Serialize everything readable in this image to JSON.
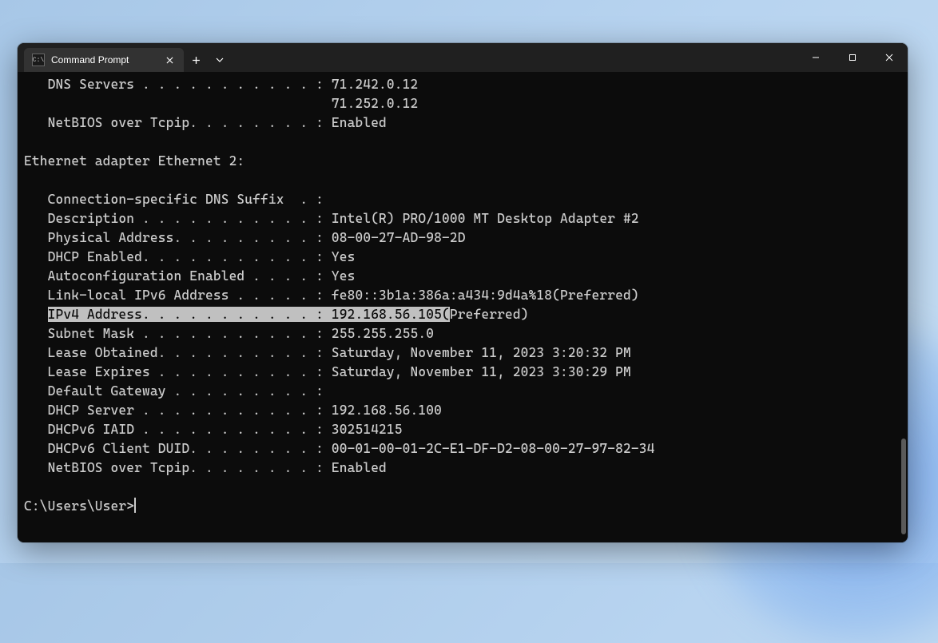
{
  "titlebar": {
    "tab_title": "Command Prompt",
    "tab_icon_text": "C:\\"
  },
  "output": {
    "partial_top": [
      "   DNS Servers . . . . . . . . . . . : 71.242.0.12",
      "                                       71.252.0.12",
      "   NetBIOS over Tcpip. . . . . . . . : Enabled",
      ""
    ],
    "section_header": "Ethernet adapter Ethernet 2:",
    "blank": "",
    "details_before_hl": [
      "   Connection-specific DNS Suffix  . :",
      "   Description . . . . . . . . . . . : Intel(R) PRO/1000 MT Desktop Adapter #2",
      "   Physical Address. . . . . . . . . : 08-00-27-AD-98-2D",
      "   DHCP Enabled. . . . . . . . . . . : Yes",
      "   Autoconfiguration Enabled . . . . : Yes",
      "   Link-local IPv6 Address . . . . . : fe80::3b1a:386a:a434:9d4a%18(Preferred)"
    ],
    "hl_prefix": "   ",
    "hl_selected": "IPv4 Address. . . . . . . . . . . : 192.168.56.105(",
    "hl_suffix": "Preferred)",
    "details_after_hl": [
      "   Subnet Mask . . . . . . . . . . . : 255.255.255.0",
      "   Lease Obtained. . . . . . . . . . : Saturday, November 11, 2023 3:20:32 PM",
      "   Lease Expires . . . . . . . . . . : Saturday, November 11, 2023 3:30:29 PM",
      "   Default Gateway . . . . . . . . . :",
      "   DHCP Server . . . . . . . . . . . : 192.168.56.100",
      "   DHCPv6 IAID . . . . . . . . . . . : 302514215",
      "   DHCPv6 Client DUID. . . . . . . . : 00-01-00-01-2C-E1-DF-D2-08-00-27-97-82-34",
      "   NetBIOS over Tcpip. . . . . . . . : Enabled",
      ""
    ],
    "prompt": "C:\\Users\\User>"
  }
}
